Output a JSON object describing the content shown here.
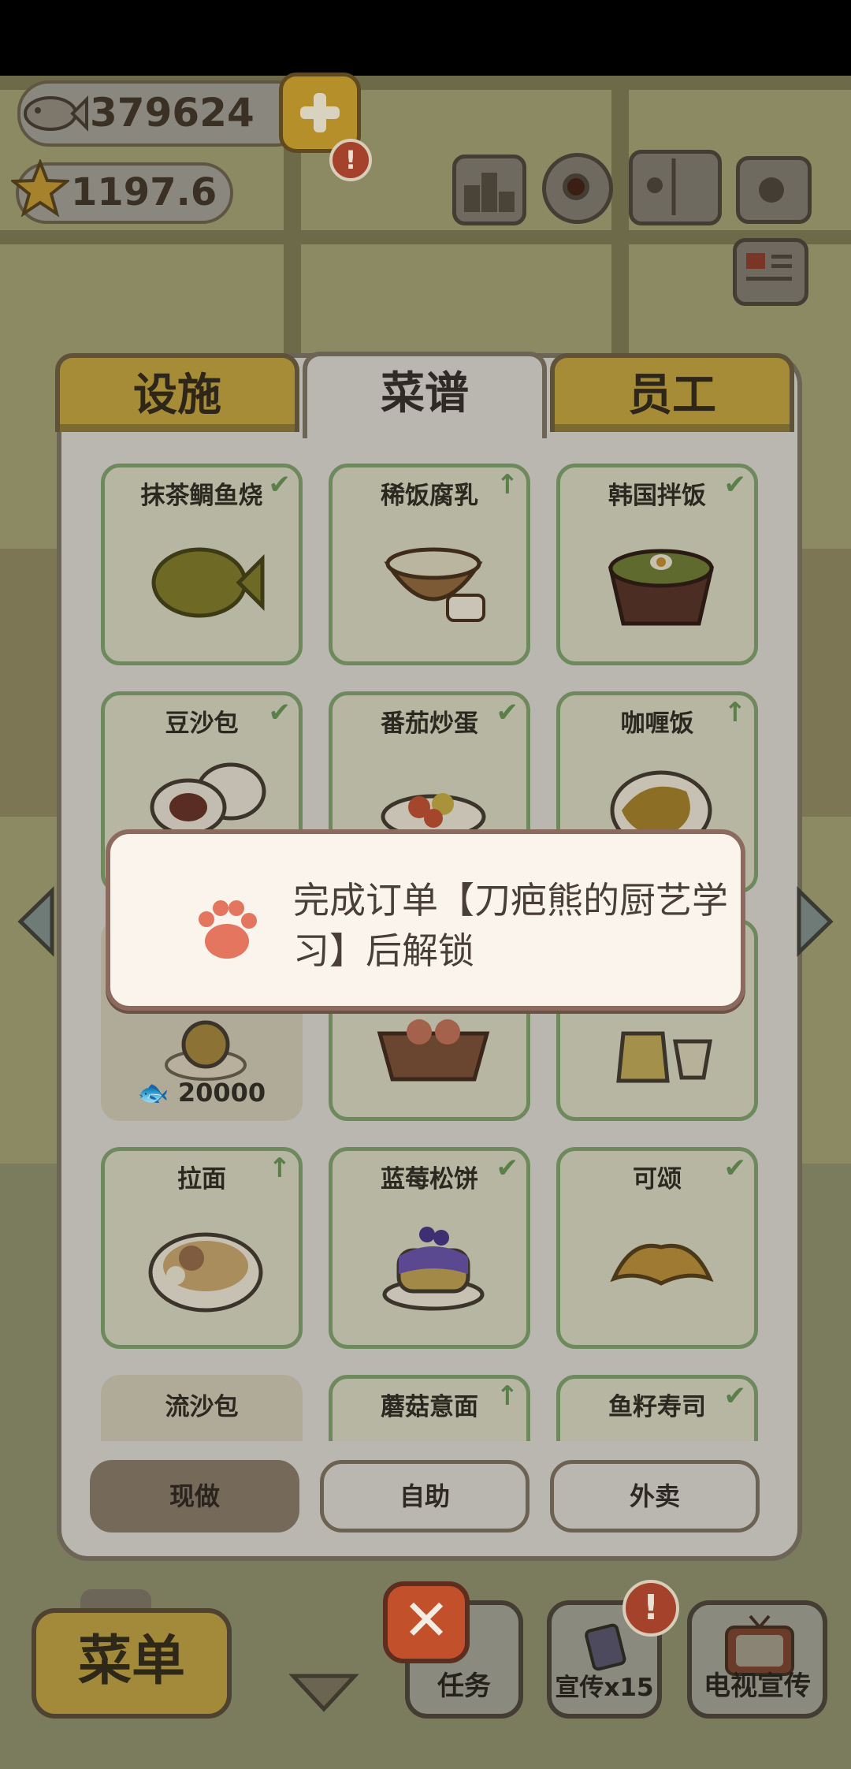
{
  "hud": {
    "fish_coins": "379624",
    "stars": "1197.6",
    "plus_alert": "!",
    "icons": [
      "ranking-icon",
      "gear-icon",
      "recipe-book-icon",
      "camera-icon",
      "newspaper-icon"
    ]
  },
  "tabs": [
    {
      "label": "设施",
      "active": false
    },
    {
      "label": "菜谱",
      "active": true
    },
    {
      "label": "员工",
      "active": false
    }
  ],
  "recipes": [
    {
      "name": "抹茶鲷鱼烧",
      "mark": "✔",
      "icon": "taiyaki-icon"
    },
    {
      "name": "稀饭腐乳",
      "mark": "↑",
      "icon": "congee-icon"
    },
    {
      "name": "韩国拌饭",
      "mark": "✔",
      "icon": "bibimbap-icon"
    },
    {
      "name": "豆沙包",
      "mark": "✔",
      "icon": "bean-bun-icon"
    },
    {
      "name": "番茄炒蛋",
      "mark": "✔",
      "icon": "tomato-egg-icon"
    },
    {
      "name": "咖喱饭",
      "mark": "↑",
      "icon": "curry-rice-icon"
    },
    {
      "name": "",
      "mark": "",
      "icon": "locked-dish-icon",
      "price": "20000",
      "locked": true
    },
    {
      "name": "",
      "mark": "",
      "icon": "shrimp-basket-icon"
    },
    {
      "name": "",
      "mark": "",
      "icon": "tea-set-icon"
    },
    {
      "name": "拉面",
      "mark": "↑",
      "icon": "ramen-icon"
    },
    {
      "name": "蓝莓松饼",
      "mark": "✔",
      "icon": "blueberry-pancake-icon"
    },
    {
      "name": "可颂",
      "mark": "✔",
      "icon": "croissant-icon"
    },
    {
      "name": "流沙包",
      "mark": "",
      "icon": "custard-bun-icon",
      "locked": true
    },
    {
      "name": "蘑菇意面",
      "mark": "↑",
      "icon": "mushroom-pasta-icon"
    },
    {
      "name": "鱼籽寿司",
      "mark": "✔",
      "icon": "roe-sushi-icon"
    }
  ],
  "modes": [
    {
      "label": "现做",
      "active": true
    },
    {
      "label": "自助",
      "active": false
    },
    {
      "label": "外卖",
      "active": false
    }
  ],
  "popup": {
    "text": "完成订单【刀疤熊的厨艺学习】后解锁",
    "icon": "paw-icon"
  },
  "bottom_bar": {
    "menu_label": "菜单",
    "task_label": "任务",
    "promo_label": "宣传x15",
    "tv_label": "电视宣传",
    "promo_alert": "!"
  },
  "colors": {
    "accent_gold": "#a68c36",
    "card_border": "#6e8a5c",
    "popup_bg": "#fbf4ec",
    "close_red": "#c2502a"
  }
}
